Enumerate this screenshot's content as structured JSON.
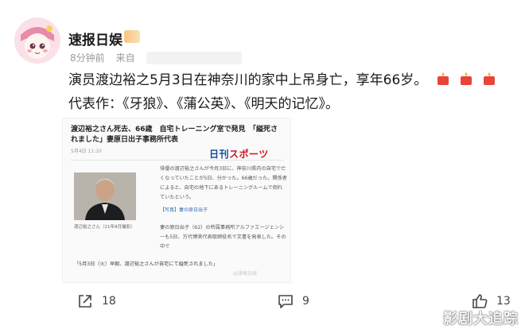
{
  "post": {
    "author": "速报日娱",
    "time": "8分钟前",
    "source_prefix": "来自",
    "line1": "演员渡边裕之5月3日在神奈川的家中上吊身亡，享年66岁。",
    "line2": "代表作：《牙狼》、《蒲公英》、《明天的记忆》。"
  },
  "article": {
    "headline": "渡辺裕之さん死去、66歳　自宅トレーニング室で発見　「縊死されました」妻原日出子事務所代表",
    "dateline": "5月4日 11:10",
    "logo_a": "日刊",
    "logo_b": "スポーツ",
    "body": "俳優の渡辺裕之さんが今月3日に、神奈川県内の自宅で亡くなっていたことが5日、分かった。66歳だった。関係者によると、自宅の地下にあるトレーニングルームで倒れていたという。",
    "photo_caption": "渡辺裕之さん（21年8月撮影）",
    "tag": "【写真】妻の原日出子",
    "body2": "妻の原日出子（62）の所属事務所アルファエージェンシーも5日、万代博実代表取締役名で文書を発表した。その中で",
    "quote": "「5月3日（火）早朝、渡辺裕之さんが自宅にて縊死されました」",
    "wm": "@速報日娱"
  },
  "toolbar": {
    "share_count": "18",
    "comment_count": "9",
    "like_count": "13"
  },
  "watermark": "影剧大追踪",
  "icons": [
    "avatar",
    "vip-badge-icon",
    "candle-icon",
    "share-icon",
    "comment-icon",
    "like-icon"
  ]
}
